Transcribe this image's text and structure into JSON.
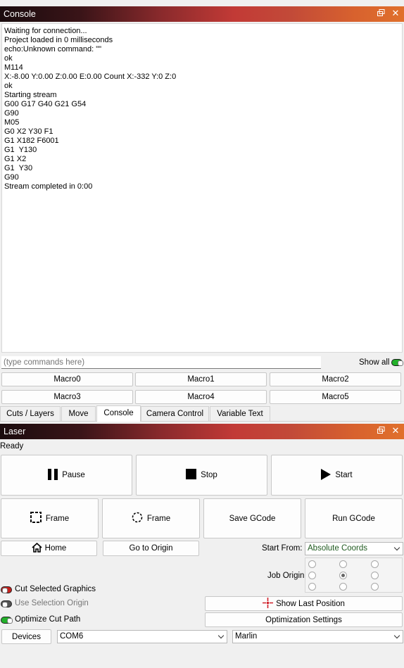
{
  "console_panel": {
    "title": "Console",
    "output_lines": [
      "Waiting for connection...",
      "Project loaded in 0 milliseconds",
      "echo:Unknown command: \"\"",
      "ok",
      "M114",
      "X:-8.00 Y:0.00 Z:0.00 E:0.00 Count X:-332 Y:0 Z:0",
      "ok",
      "Starting stream",
      "G00 G17 G40 G21 G54",
      "G90",
      "M05",
      "G0 X2 Y30 F1",
      "G1 X182 F6001",
      "G1  Y130",
      "G1 X2",
      "G1  Y30",
      "G90",
      "Stream completed in 0:00"
    ],
    "command_placeholder": "(type commands here)",
    "show_all_label": "Show all",
    "show_all_on": true,
    "macros": [
      "Macro0",
      "Macro1",
      "Macro2",
      "Macro3",
      "Macro4",
      "Macro5"
    ]
  },
  "tabs": [
    "Cuts / Layers",
    "Move",
    "Console",
    "Camera Control",
    "Variable Text"
  ],
  "active_tab": "Console",
  "laser_panel": {
    "title": "Laser",
    "status": "Ready",
    "pause_label": "Pause",
    "stop_label": "Stop",
    "start_label": "Start",
    "frame_label": "Frame",
    "frame_circle_label": "Frame",
    "save_gcode_label": "Save GCode",
    "run_gcode_label": "Run GCode",
    "home_label": "Home",
    "go_to_origin_label": "Go to Origin",
    "start_from_label": "Start From:",
    "start_from_value": "Absolute Coords",
    "job_origin_label": "Job Origin",
    "job_origin_selected": 4,
    "cut_selected_label": "Cut Selected Graphics",
    "use_selection_origin_label": "Use Selection Origin",
    "optimize_cut_path_label": "Optimize Cut Path",
    "show_last_position_label": "Show Last Position",
    "optimization_settings_label": "Optimization Settings",
    "devices_label": "Devices",
    "port_value": "COM6",
    "firmware_value": "Marlin"
  },
  "colors": {
    "toggle_on": "#22b12a",
    "toggle_red": "#c8201c",
    "toggle_off": "#555555",
    "start_from_text": "#1f5a1f"
  }
}
